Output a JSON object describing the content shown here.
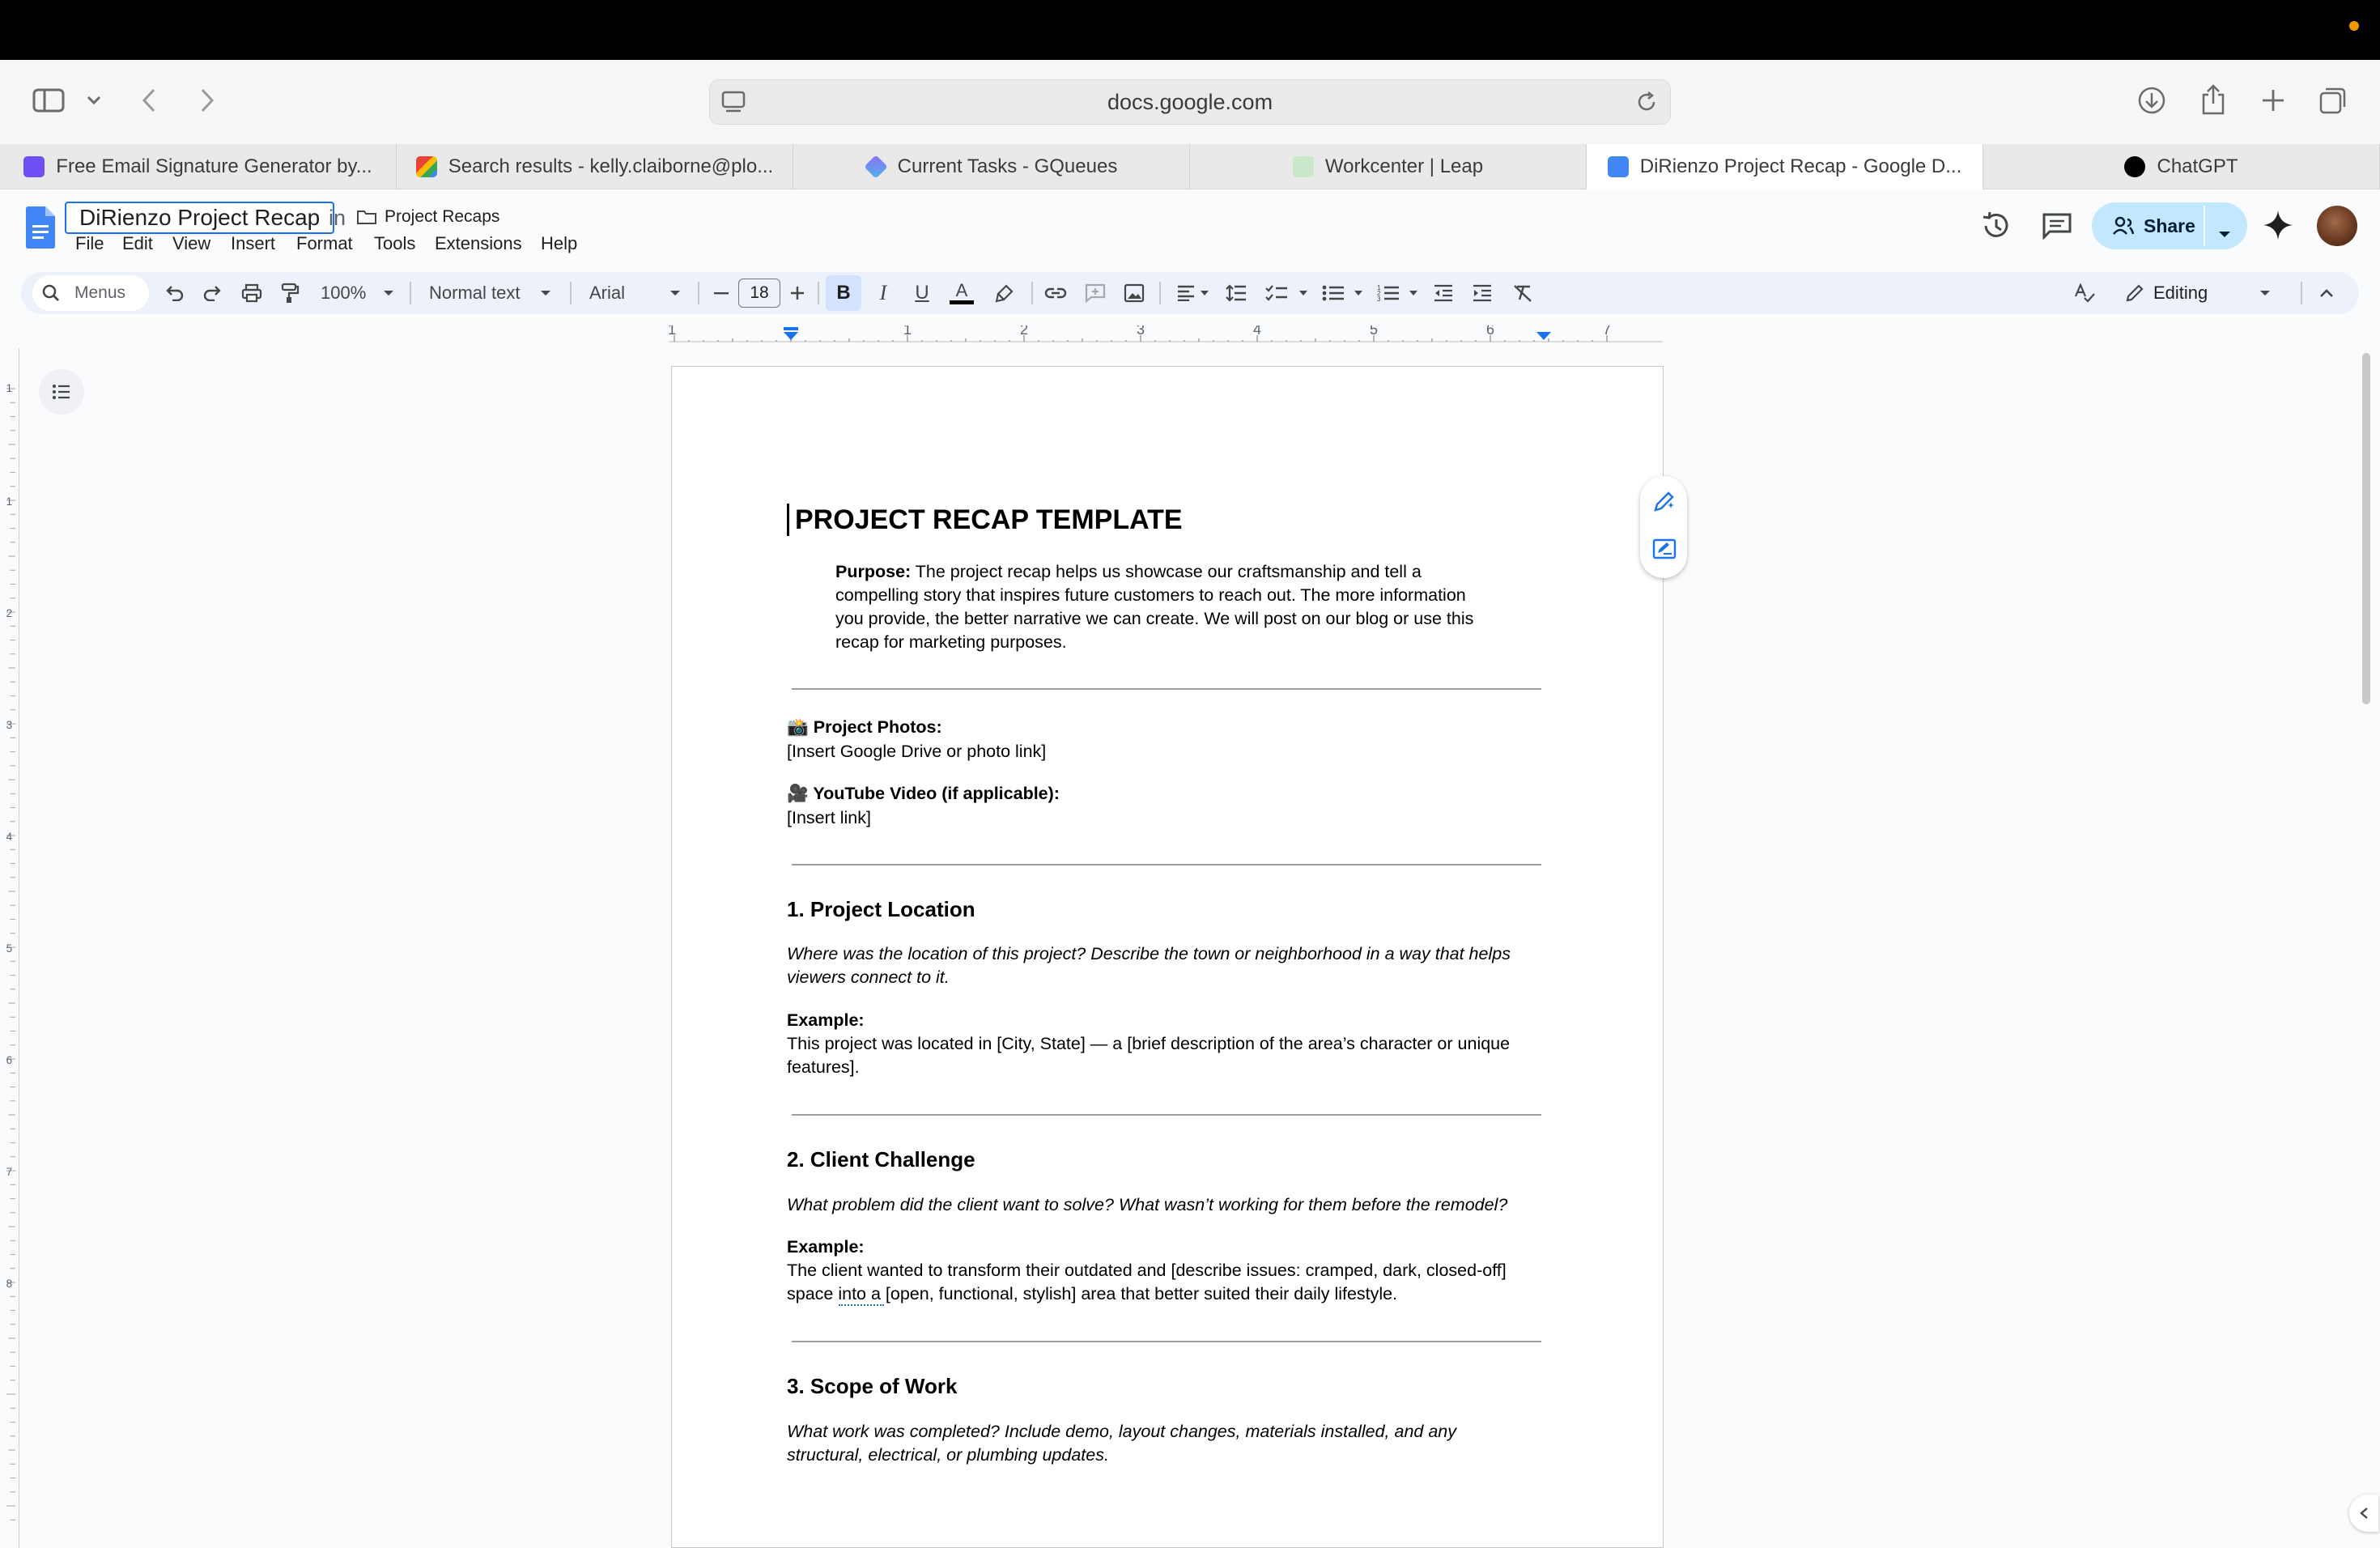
{
  "browser": {
    "url": "docs.google.com",
    "tabs": [
      {
        "label": "Free Email Signature Generator by...",
        "color": "#6f4ef2"
      },
      {
        "label": "Search results - kelly.claiborne@plo...",
        "color": "#ea4335"
      },
      {
        "label": "Current Tasks - GQueues",
        "color": "#8e6ff7"
      },
      {
        "label": "Workcenter | Leap",
        "color": "#34a853"
      },
      {
        "label": "DiRienzo Project Recap - Google D...",
        "color": "#4285f4"
      },
      {
        "label": "ChatGPT",
        "color": "#000000"
      }
    ]
  },
  "docs": {
    "title": "DiRienzo Project Recap",
    "in_label": "in",
    "folder": "Project Recaps",
    "menus": [
      "File",
      "Edit",
      "View",
      "Insert",
      "Format",
      "Tools",
      "Extensions",
      "Help"
    ],
    "share_label": "Share",
    "toolbar": {
      "menus_search": "Menus",
      "zoom": "100%",
      "style": "Normal text",
      "font": "Arial",
      "font_size": "18",
      "mode": "Editing"
    },
    "ruler_numbers": [
      "1",
      "1",
      "2",
      "3",
      "4",
      "5",
      "6",
      "7"
    ],
    "vruler_numbers": [
      "1",
      "1",
      "2",
      "3",
      "4",
      "5",
      "6",
      "7",
      "8"
    ]
  },
  "document": {
    "heading": "PROJECT RECAP TEMPLATE",
    "purpose_label": "Purpose:",
    "purpose_lines": [
      " The project recap helps us showcase our craftsmanship and tell a",
      "compelling story that inspires future customers to reach out. The more information",
      "you provide, the better narrative we can create. We will post on our blog or use this",
      "recap for marketing purposes."
    ],
    "photos_label": "📸 Project Photos:",
    "photos_value": "[Insert Google Drive or photo link]",
    "video_label": "🎥 YouTube Video (if applicable):",
    "video_value": "[Insert link]",
    "sections": [
      {
        "heading": "1. Project Location",
        "prompt_lines": [
          "Where was the location of this project? Describe the town or neighborhood in a way that helps",
          "viewers connect to it."
        ],
        "example_label": "Example:",
        "example_lines": [
          "This project was located in [City, State] — a [brief description of the area’s character or unique",
          "features]."
        ]
      },
      {
        "heading": "2. Client Challenge",
        "prompt_lines": [
          "What problem did the client want to solve? What wasn’t working for them before the remodel?"
        ],
        "example_label": "Example:",
        "example_lines": [
          "The client wanted to transform their outdated and [describe issues: cramped, dark, closed-off]",
          "space into a [open, functional, stylish] area that better suited their daily lifestyle."
        ]
      },
      {
        "heading": "3. Scope of Work",
        "prompt_lines": [
          "What work was completed? Include demo, layout changes, materials installed, and any",
          "structural, electrical, or plumbing updates."
        ]
      }
    ]
  }
}
